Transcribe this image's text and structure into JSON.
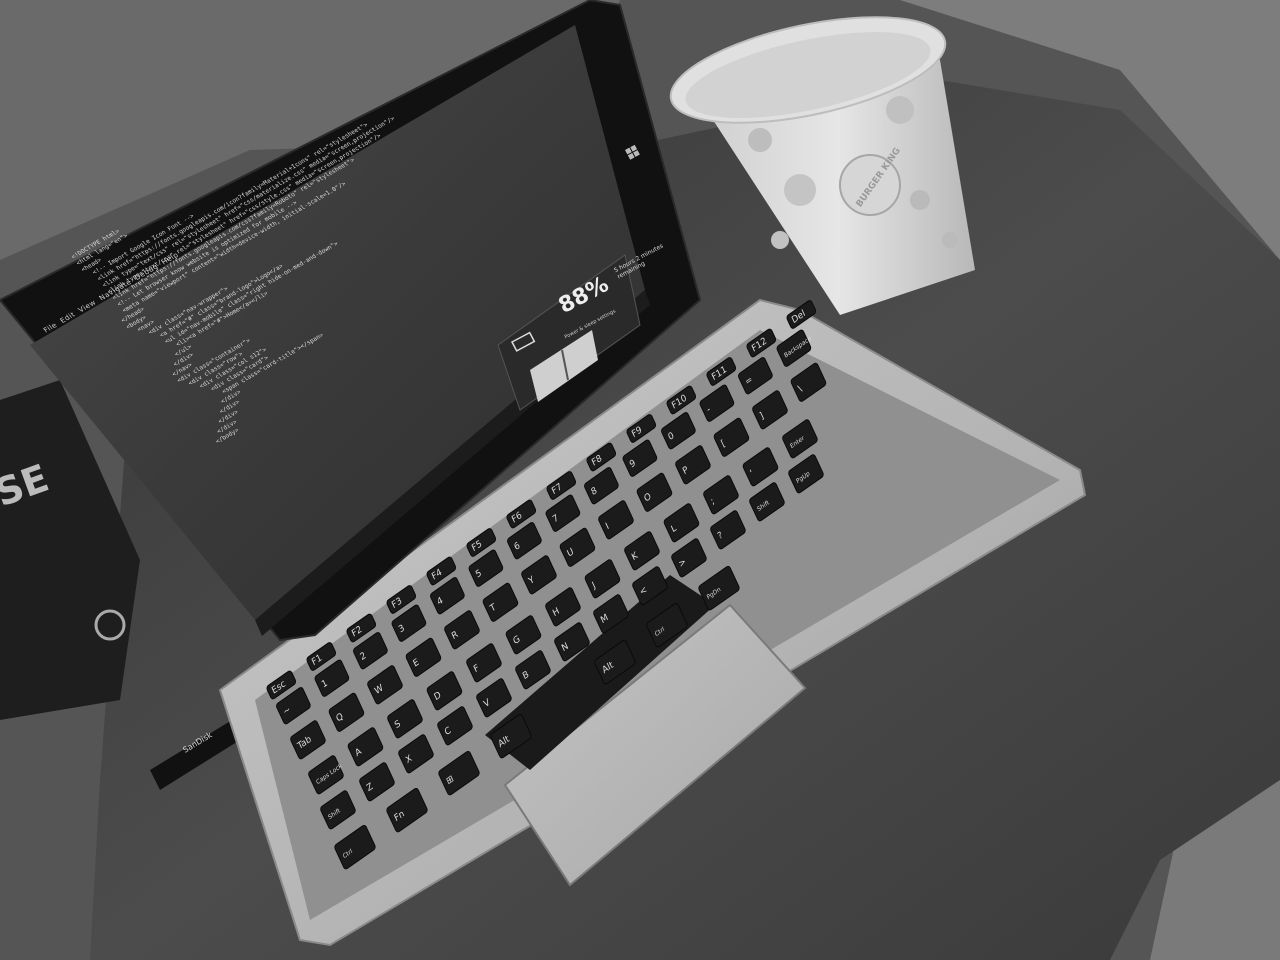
{
  "screen": {
    "menu": [
      "File",
      "Edit",
      "View",
      "Navigate",
      "Debug",
      "Help"
    ],
    "code_lines": [
      "<!DOCTYPE html>",
      "<html lang=\"en\">",
      "<head>",
      "  <!-- Import Google Icon Font -->",
      "  <link href=\"https://fonts.googleapis.com/icon?family=Material+Icons\" rel=\"stylesheet\">",
      "  <link type=\"text/css\" rel=\"stylesheet\" href=\"css/materialize.css\" media=\"screen,projection\"/>",
      "  <link type=\"text/css\" rel=\"stylesheet\" href=\"css/style.css\" media=\"screen,projection\"/>",
      "  <link href=\"https://fonts.googleapis.com/css?family=Roboto\" rel=\"stylesheet\">",
      "",
      "  <!-- Let browser know website is optimized for mobile -->",
      "  <meta name=\"viewport\" content=\"width=device-width, initial-scale=1.0\"/>",
      "</head>",
      "<body>",
      "  <nav>",
      "    <div class=\"nav-wrapper\">",
      "      <a href=\"#\" class=\"brand-logo\">Logo</a>",
      "      <ul id=\"nav-mobile\" class=\"right hide-on-med-and-down\">",
      "        <li><a href=\"#\">Home</a></li>",
      "      </ul>",
      "    </div>",
      "  </nav>",
      "  <div class=\"container\">",
      "    <div class=\"row\">",
      "      <div class=\"col s12\">",
      "        <div class=\"card\">",
      "          <span class=\"card-title\"></span>",
      "        </div>",
      "      </div>",
      "    </div>",
      "  </div>",
      "</body>"
    ],
    "battery": {
      "percent": "88%",
      "status": "5 hours 2 minutes remaining",
      "mode_label": "Power & sleep settings"
    }
  },
  "keyboard": {
    "row_fn": [
      "Esc",
      "F1",
      "F2",
      "F3",
      "F4",
      "F5",
      "F6",
      "F7",
      "F8",
      "F9",
      "F10",
      "F11",
      "F12",
      "Del"
    ],
    "row_num": [
      "~",
      "1",
      "2",
      "3",
      "4",
      "5",
      "6",
      "7",
      "8",
      "9",
      "0",
      "-",
      "=",
      "Backspace"
    ],
    "row_q": [
      "Tab",
      "Q",
      "W",
      "E",
      "R",
      "T",
      "Y",
      "U",
      "I",
      "O",
      "P",
      "[",
      "]",
      "\\"
    ],
    "row_a": [
      "Caps Lock",
      "A",
      "S",
      "D",
      "F",
      "G",
      "H",
      "J",
      "K",
      "L",
      ";",
      "'",
      "Enter"
    ],
    "row_z": [
      "Shift",
      "Z",
      "X",
      "C",
      "V",
      "B",
      "N",
      "M",
      "<",
      ">",
      "?",
      "Shift",
      "PgUp"
    ],
    "row_bottom": [
      "Ctrl",
      "Fn",
      "⊞",
      "Alt",
      "",
      "Alt",
      "Ctrl",
      "PgDn"
    ]
  },
  "cup": {
    "logo": "BURGER KING"
  },
  "usb": {
    "label": "SanDisk"
  }
}
